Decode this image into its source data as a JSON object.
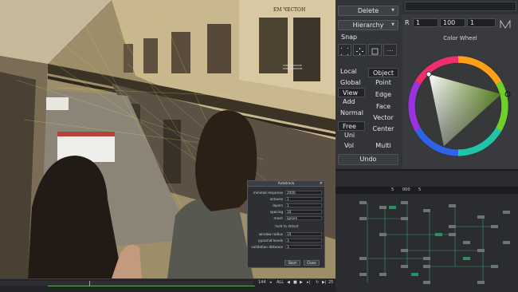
{
  "viewport": {
    "signs": [
      "ЕМ ЧЕСТОН",
      "СПЕЦИАЛЬНОЕ\nПРЕДЛОЖЕНИЕ"
    ]
  },
  "autotrack": {
    "title": "Autotrack",
    "fields": [
      {
        "label": "minimal response",
        "value": "2000"
      },
      {
        "label": "octaves",
        "value": "1"
      },
      {
        "label": "layers",
        "value": "1"
      },
      {
        "label": "spacing",
        "value": "10"
      },
      {
        "label": "mesh",
        "value": "ignore"
      }
    ],
    "section_label": "hold to detect",
    "fields2": [
      {
        "label": "window radius",
        "value": "10"
      },
      {
        "label": "pyramid levels",
        "value": "3"
      },
      {
        "label": "validation distance",
        "value": "3"
      }
    ],
    "start_label": "Start",
    "close_label": "Close"
  },
  "timeline": {
    "frame": "144",
    "all_label": "ALL",
    "end_frame": "25"
  },
  "tools": {
    "delete_label": "Delete",
    "hierarchy_label": "Hierarchy",
    "snap_label": "Snap",
    "snap_icons": [
      "snap-grid-icon",
      "snap-move-icon",
      "snap-box-icon",
      "more-icon"
    ],
    "snap_more": "...",
    "space_options": [
      "Local",
      "Global",
      "View",
      "Add",
      "Normal"
    ],
    "selected_space": "View",
    "selection_modes": [
      "Object",
      "Point",
      "Edge",
      "Face",
      "Vector",
      "Center"
    ],
    "selected_mode": "Object",
    "select_options": [
      "Free",
      "Uni",
      "Vol"
    ],
    "selected_select": "Free",
    "multi_label": "Multi",
    "undo_label": "Undo"
  },
  "colorpanel": {
    "r_label": "R",
    "r_value": "1",
    "g_value": "100",
    "b_value": "1",
    "title": "Color Wheel",
    "accent": "#2b8f66"
  },
  "nodes": {
    "frame_label": "5",
    "value_label": "000",
    "count_label": "5"
  }
}
